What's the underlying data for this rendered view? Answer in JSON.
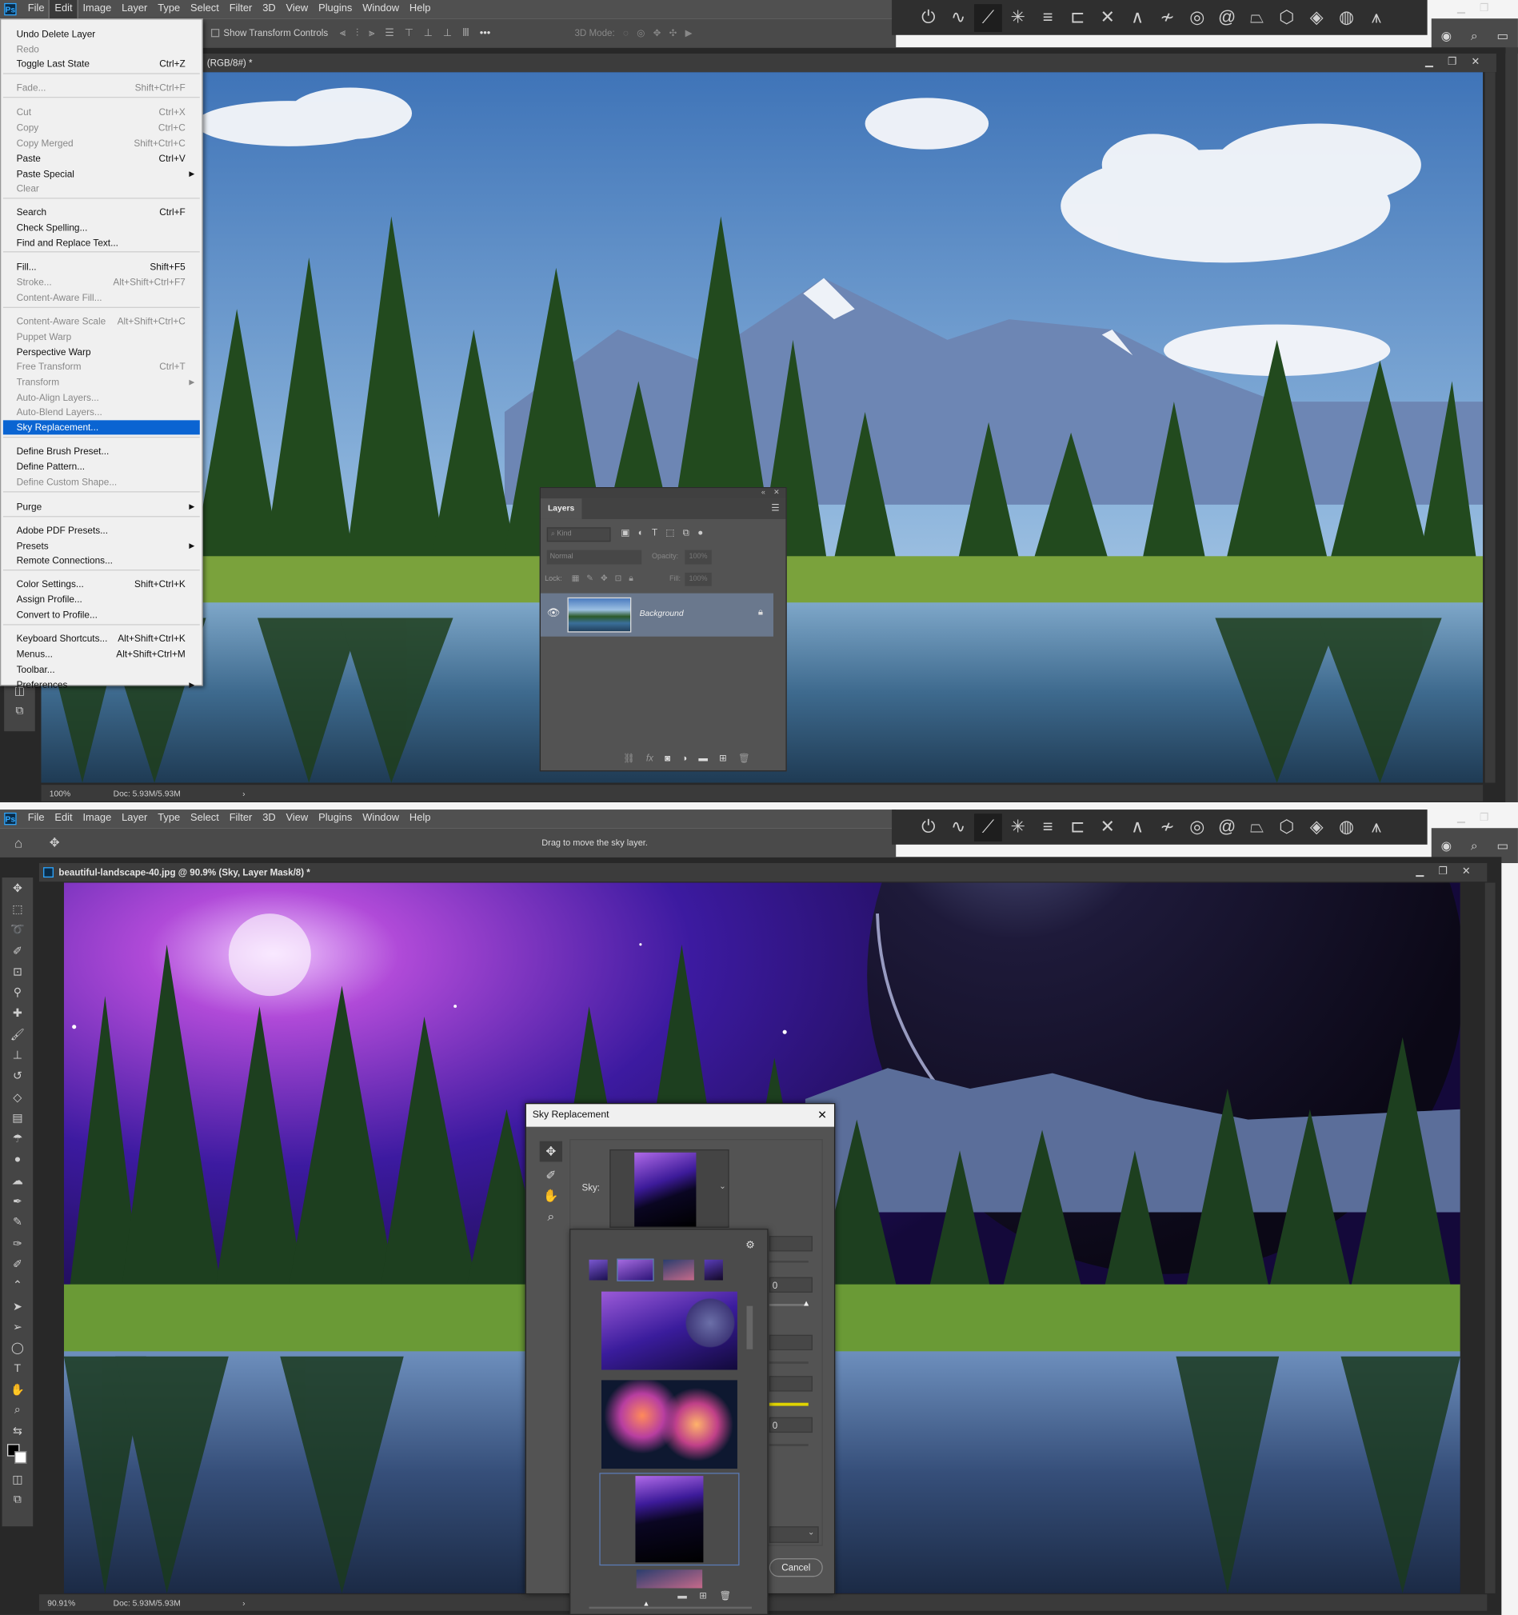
{
  "app": {
    "logo": "Ps"
  },
  "menubar": {
    "items": [
      "File",
      "Edit",
      "Image",
      "Layer",
      "Type",
      "Select",
      "Filter",
      "3D",
      "View",
      "Plugins",
      "Window",
      "Help"
    ],
    "active": "Edit"
  },
  "options_top": {
    "show_transform_controls": "Show Transform Controls",
    "mode_3d": "3D Mode:"
  },
  "options_bottom": {
    "hint": "Drag to move the sky layer."
  },
  "edit_menu": {
    "items": [
      {
        "label": "Undo Delete Layer",
        "shortcut": "",
        "disabled": false
      },
      {
        "label": "Redo",
        "shortcut": "",
        "disabled": true
      },
      {
        "label": "Toggle Last State",
        "shortcut": "Ctrl+Z",
        "disabled": false
      },
      {
        "label": "Fade...",
        "shortcut": "Shift+Ctrl+F",
        "disabled": true
      },
      {
        "label": "Cut",
        "shortcut": "Ctrl+X",
        "disabled": true
      },
      {
        "label": "Copy",
        "shortcut": "Ctrl+C",
        "disabled": true
      },
      {
        "label": "Copy Merged",
        "shortcut": "Shift+Ctrl+C",
        "disabled": true
      },
      {
        "label": "Paste",
        "shortcut": "Ctrl+V",
        "disabled": false
      },
      {
        "label": "Paste Special",
        "shortcut": "",
        "disabled": false,
        "submenu": true
      },
      {
        "label": "Clear",
        "shortcut": "",
        "disabled": true
      },
      {
        "label": "Search",
        "shortcut": "Ctrl+F",
        "disabled": false
      },
      {
        "label": "Check Spelling...",
        "shortcut": "",
        "disabled": false
      },
      {
        "label": "Find and Replace Text...",
        "shortcut": "",
        "disabled": false
      },
      {
        "label": "Fill...",
        "shortcut": "Shift+F5",
        "disabled": false
      },
      {
        "label": "Stroke...",
        "shortcut": "Alt+Shift+Ctrl+F7",
        "disabled": true
      },
      {
        "label": "Content-Aware Fill...",
        "shortcut": "",
        "disabled": true
      },
      {
        "label": "Content-Aware Scale",
        "shortcut": "Alt+Shift+Ctrl+C",
        "disabled": true
      },
      {
        "label": "Puppet Warp",
        "shortcut": "",
        "disabled": true
      },
      {
        "label": "Perspective Warp",
        "shortcut": "",
        "disabled": false
      },
      {
        "label": "Free Transform",
        "shortcut": "Ctrl+T",
        "disabled": true
      },
      {
        "label": "Transform",
        "shortcut": "",
        "disabled": true,
        "submenu": true
      },
      {
        "label": "Auto-Align Layers...",
        "shortcut": "",
        "disabled": true
      },
      {
        "label": "Auto-Blend Layers...",
        "shortcut": "",
        "disabled": true
      },
      {
        "label": "Sky Replacement...",
        "shortcut": "",
        "disabled": false,
        "highlighted": true
      },
      {
        "label": "Define Brush Preset...",
        "shortcut": "",
        "disabled": false
      },
      {
        "label": "Define Pattern...",
        "shortcut": "",
        "disabled": false
      },
      {
        "label": "Define Custom Shape...",
        "shortcut": "",
        "disabled": true
      },
      {
        "label": "Purge",
        "shortcut": "",
        "disabled": false,
        "submenu": true
      },
      {
        "label": "Adobe PDF Presets...",
        "shortcut": "",
        "disabled": false
      },
      {
        "label": "Presets",
        "shortcut": "",
        "disabled": false,
        "submenu": true
      },
      {
        "label": "Remote Connections...",
        "shortcut": "",
        "disabled": false
      },
      {
        "label": "Color Settings...",
        "shortcut": "Shift+Ctrl+K",
        "disabled": false
      },
      {
        "label": "Assign Profile...",
        "shortcut": "",
        "disabled": false
      },
      {
        "label": "Convert to Profile...",
        "shortcut": "",
        "disabled": false
      },
      {
        "label": "Keyboard Shortcuts...",
        "shortcut": "Alt+Shift+Ctrl+K",
        "disabled": false
      },
      {
        "label": "Menus...",
        "shortcut": "Alt+Shift+Ctrl+M",
        "disabled": false
      },
      {
        "label": "Toolbar...",
        "shortcut": "",
        "disabled": false
      },
      {
        "label": "Preferences",
        "shortcut": "",
        "disabled": false,
        "submenu": true
      }
    ]
  },
  "doc1": {
    "tab_title": "(RGB/8#) *",
    "zoom": "100%",
    "doc_size": "Doc: 5.93M/5.93M"
  },
  "doc2": {
    "tab_title": "beautiful-landscape-40.jpg @ 90.9% (Sky, Layer Mask/8) *",
    "zoom": "90.91%",
    "doc_size": "Doc: 5.93M/5.93M"
  },
  "layers_panel": {
    "title": "Layers",
    "filter_placeholder": "Kind",
    "blend_mode": "Normal",
    "opacity_label": "Opacity:",
    "opacity_value": "100%",
    "lock_label": "Lock:",
    "fill_label": "Fill:",
    "fill_value": "100%",
    "layer_name": "Background"
  },
  "sky_dialog": {
    "title": "Sky Replacement",
    "sky_label": "Sky:",
    "value_1": "0",
    "value_2": "0",
    "cancel_label": "Cancel"
  },
  "colors": {
    "accent_blue": "#0a64d2",
    "ps_blue": "#31a8ff",
    "panel_gray": "#535353",
    "ui_dark": "#282828"
  }
}
